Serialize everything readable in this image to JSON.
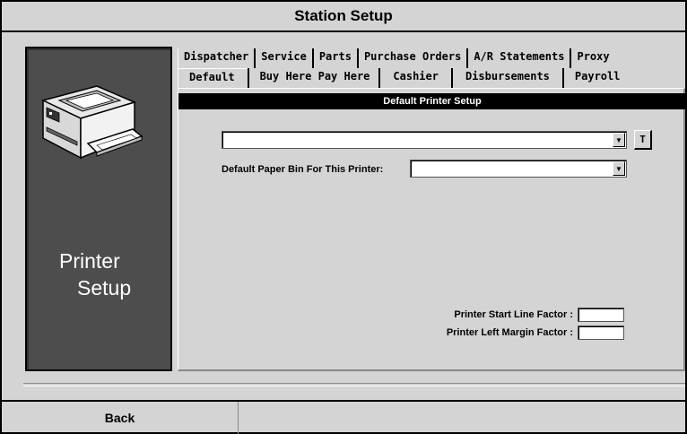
{
  "window": {
    "title": "Station Setup"
  },
  "left_panel": {
    "title_line1": "Printer",
    "title_line2": "Setup",
    "image_icon": "printer-icon"
  },
  "tabs": {
    "row1": [
      "Dispatcher",
      "Service",
      "Parts",
      "Purchase Orders",
      "A/R Statements",
      "Proxy"
    ],
    "row2": [
      "Default",
      "Buy Here Pay Here",
      "Cashier",
      "Disbursements",
      "Payroll"
    ],
    "active": "Default"
  },
  "content": {
    "header": "Default Printer Setup",
    "printer_select": {
      "value": ""
    },
    "test_button": "T",
    "paper_bin_label": "Default Paper Bin For This Printer:",
    "paper_bin_select": {
      "value": ""
    },
    "start_line_label": "Printer Start Line Factor :",
    "start_line_value": "",
    "left_margin_label": "Printer Left Margin Factor :",
    "left_margin_value": ""
  },
  "footer": {
    "back_label": "Back"
  }
}
